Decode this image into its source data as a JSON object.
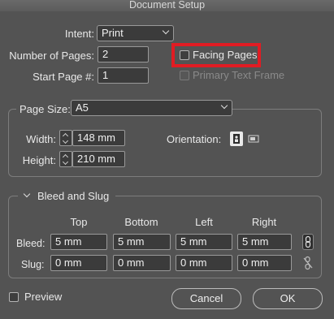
{
  "window": {
    "title": "Document Setup"
  },
  "intent": {
    "label": "Intent:",
    "value": "Print"
  },
  "pages": {
    "number_label": "Number of Pages:",
    "number_value": "2",
    "start_label": "Start Page #:",
    "start_value": "1",
    "facing_pages_label": "Facing Pages",
    "facing_pages_checked": false,
    "primary_text_frame_label": "Primary Text Frame",
    "primary_text_frame_checked": false
  },
  "page_size": {
    "label": "Page Size:",
    "value": "A5",
    "width_label": "Width:",
    "width_value": "148 mm",
    "height_label": "Height:",
    "height_value": "210 mm",
    "orientation_label": "Orientation:",
    "orientation_selected": "portrait"
  },
  "bleed_slug": {
    "title": "Bleed and Slug",
    "columns": [
      "Top",
      "Bottom",
      "Left",
      "Right"
    ],
    "bleed_label": "Bleed:",
    "bleed_values": [
      "5 mm",
      "5 mm",
      "5 mm",
      "5 mm"
    ],
    "bleed_linked": true,
    "slug_label": "Slug:",
    "slug_values": [
      "0 mm",
      "0 mm",
      "0 mm",
      "0 mm"
    ],
    "slug_linked": false
  },
  "footer": {
    "preview_label": "Preview",
    "preview_checked": false,
    "cancel_label": "Cancel",
    "ok_label": "OK"
  },
  "colors": {
    "background": "#535353",
    "field_bg": "#3b3b3b",
    "highlight": "#e11c23"
  }
}
